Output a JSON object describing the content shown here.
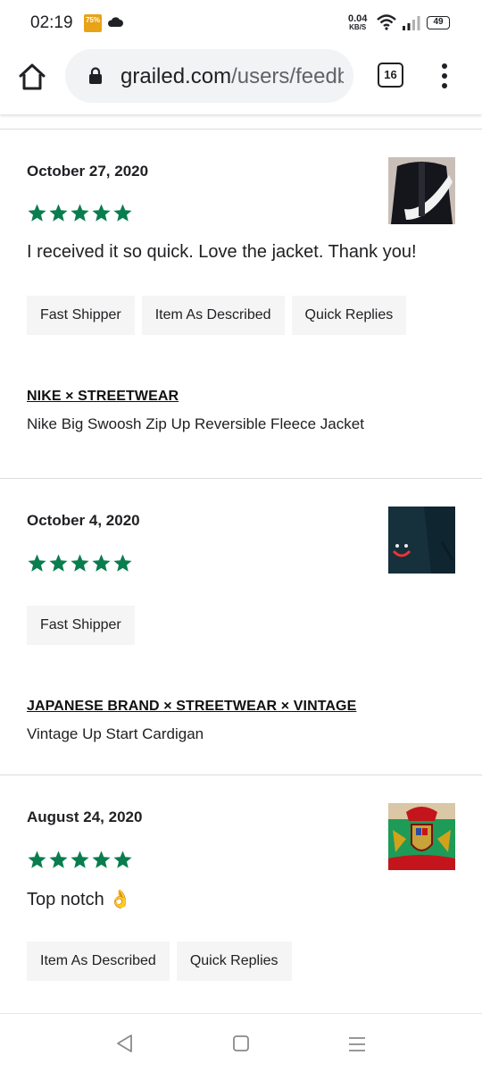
{
  "status_bar": {
    "time": "02:19",
    "badge": "75%",
    "net_speed": "0.04",
    "net_unit": "KB/S",
    "battery": "49",
    "icons": [
      "battery-saver-icon",
      "cloud-icon",
      "wifi-icon",
      "signal-icon",
      "battery-icon"
    ]
  },
  "browser": {
    "url_host": "grailed.com",
    "url_path": "/users/feedback",
    "tab_count": "16"
  },
  "reviews": [
    {
      "date": "October 27, 2020",
      "rating": 5,
      "text": "I received it so quick. Love the jacket. Thank you!",
      "tags": [
        "Fast Shipper",
        "Item As Described",
        "Quick Replies"
      ],
      "brand": "NIKE × STREETWEAR",
      "item": "Nike Big Swoosh Zip Up Reversible Fleece Jacket"
    },
    {
      "date": "October 4, 2020",
      "rating": 5,
      "text": "",
      "tags": [
        "Fast Shipper"
      ],
      "brand": "JAPANESE BRAND × STREETWEAR × VINTAGE",
      "item": "Vintage Up Start Cardigan"
    },
    {
      "date": "August 24, 2020",
      "rating": 5,
      "text": "Top notch 👌",
      "tags": [
        "Item As Described",
        "Quick Replies"
      ],
      "brand": "",
      "item": ""
    }
  ],
  "colors": {
    "star": "#0a7d4f",
    "tag_bg": "#f5f5f5",
    "divider": "#dcdcdc"
  }
}
